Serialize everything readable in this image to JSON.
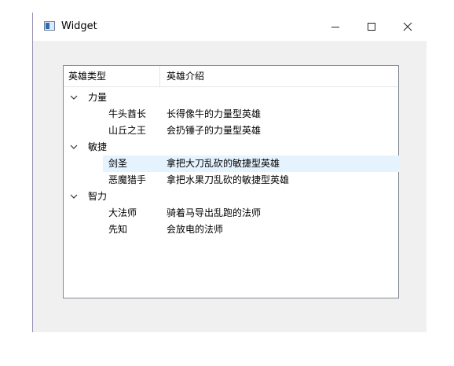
{
  "window": {
    "title": "Widget"
  },
  "tree": {
    "headers": [
      "英雄类型",
      "英雄介绍"
    ],
    "groups": [
      {
        "label": "力量",
        "children": [
          {
            "name": "牛头酋长",
            "desc": "长得像牛的力量型英雄"
          },
          {
            "name": "山丘之王",
            "desc": "会扔锤子的力量型英雄"
          }
        ]
      },
      {
        "label": "敏捷",
        "children": [
          {
            "name": "剑圣",
            "desc": "拿把大刀乱砍的敏捷型英雄"
          },
          {
            "name": "恶魔猎手",
            "desc": "拿把水果刀乱砍的敏捷型英雄"
          }
        ]
      },
      {
        "label": "智力",
        "children": [
          {
            "name": "大法师",
            "desc": "骑着马导出乱跑的法师"
          },
          {
            "name": "先知",
            "desc": "会放电的法师"
          }
        ]
      }
    ]
  },
  "selected_item": "剑圣",
  "icons": {
    "expand": "chevron-down-icon",
    "minimize": "minimize-icon",
    "maximize": "maximize-icon",
    "close": "close-icon"
  }
}
